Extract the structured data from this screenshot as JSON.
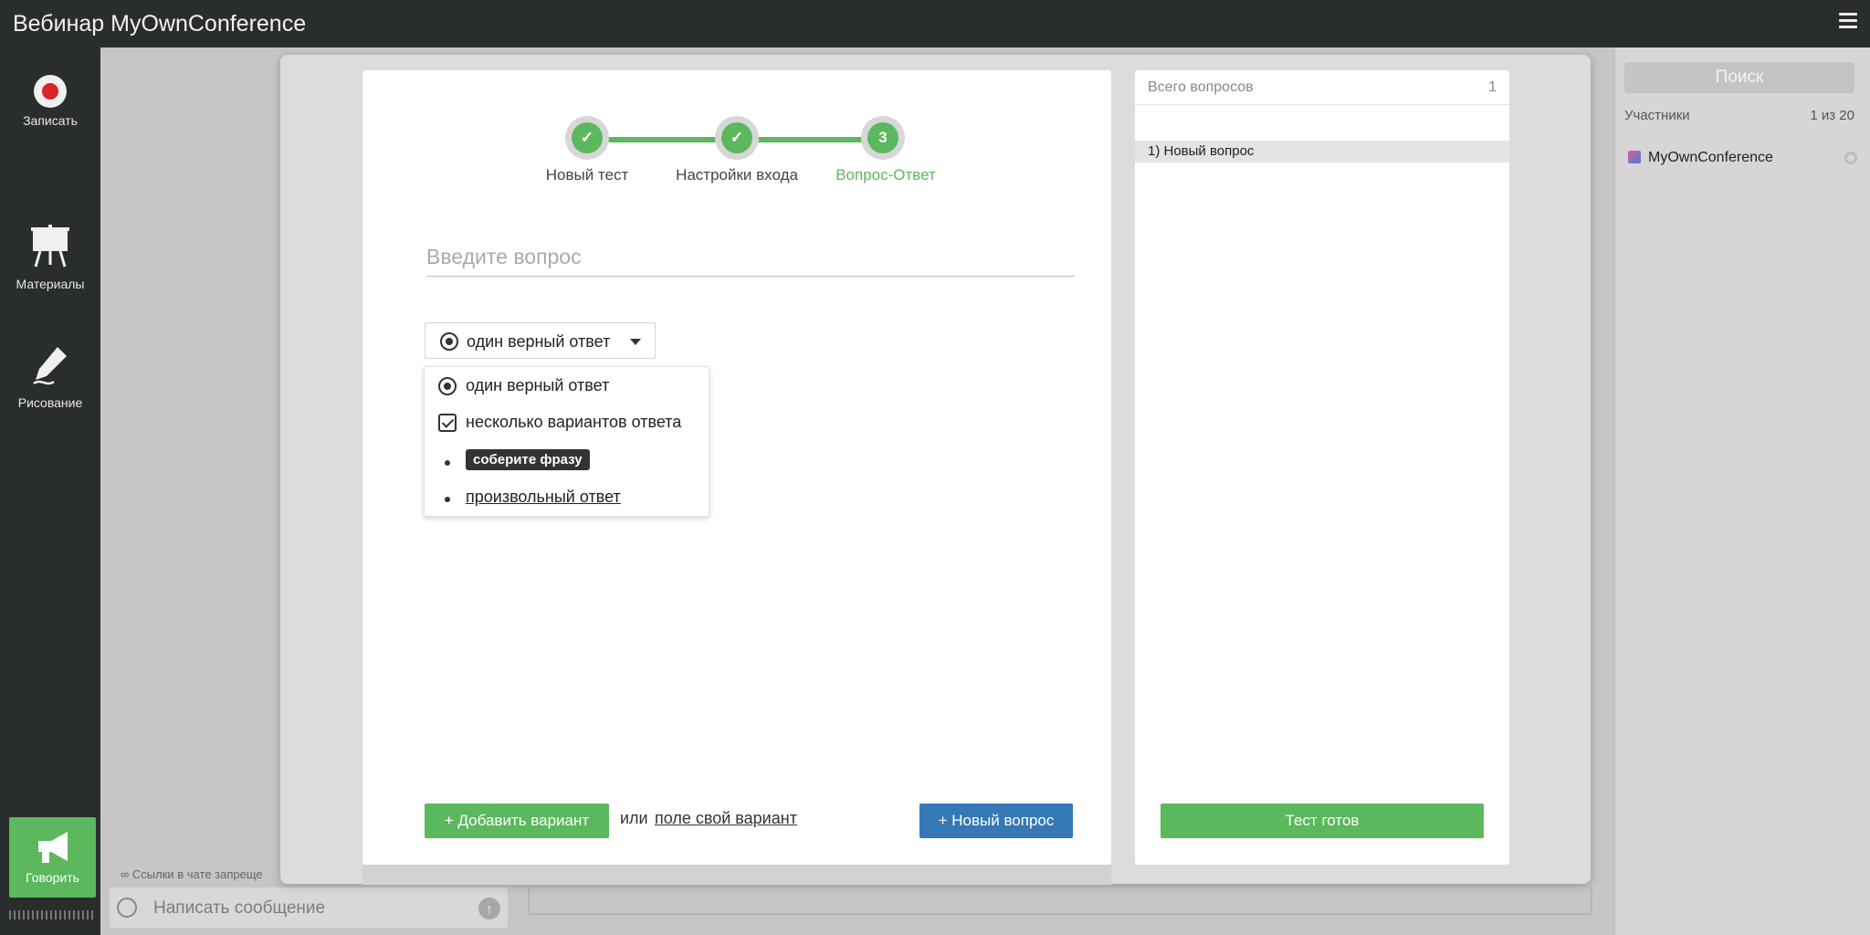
{
  "app": {
    "title": "Вебинар MyOwnConference"
  },
  "sidebar": {
    "record_label": "Записать",
    "materials_label": "Материалы",
    "drawing_label": "Рисование",
    "speak_label": "Говорить"
  },
  "chat": {
    "note": "Ссылки в чате запреще",
    "placeholder": "Написать сообщение"
  },
  "right_panel": {
    "search_label": "Поиск",
    "participants_label": "Участники",
    "participants_count": "1 из 20",
    "user_name": "MyOwnConference"
  },
  "wizard": {
    "steps": [
      {
        "label": "Новый тест",
        "state": "done"
      },
      {
        "label": "Настройки входа",
        "state": "done"
      },
      {
        "label": "Вопрос-Ответ",
        "state": "active",
        "number": "3"
      }
    ],
    "question_placeholder": "Введите вопрос",
    "answer_type_selected": "один верный ответ",
    "answer_type_options": [
      "один верный ответ",
      "несколько вариантов ответа",
      "соберите фразу",
      "произвольный ответ"
    ],
    "add_variant_label": "+ Добавить вариант",
    "or_label": "или",
    "own_variant_label": "поле свой вариант",
    "new_question_label": "+ Новый вопрос"
  },
  "questions": {
    "total_label": "Всего вопросов",
    "total_count": "1",
    "items": [
      "1) Новый вопрос"
    ],
    "done_label": "Тест готов"
  },
  "colors": {
    "accent_green": "#5bb85d",
    "accent_blue": "#3578b5",
    "chrome_dark": "#2a2d2d",
    "record_red": "#d9222a"
  }
}
